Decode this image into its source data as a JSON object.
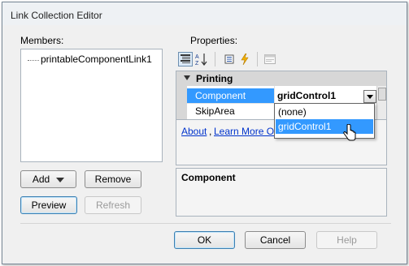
{
  "window": {
    "title": "Link Collection Editor"
  },
  "members": {
    "label": "Members:",
    "items": [
      {
        "label": "printableComponentLink1"
      }
    ]
  },
  "properties": {
    "label": "Properties:",
    "toolbar": [
      "categorized-icon",
      "alphabetical-icon",
      "property-pages-icon",
      "events-icon",
      "properties-icon"
    ],
    "category": "Printing",
    "rows": [
      {
        "name": "Component",
        "value": "gridControl1",
        "selected": true
      },
      {
        "name": "SkipArea",
        "value": ""
      }
    ],
    "dropdown_options": [
      "(none)",
      "gridControl1"
    ],
    "dropdown_highlighted": "gridControl1",
    "links": [
      "About",
      "Learn More Or"
    ],
    "links_separator": ",",
    "description_title": "Component"
  },
  "buttons": {
    "add": "Add",
    "remove": "Remove",
    "preview": "Preview",
    "refresh": "Refresh",
    "ok": "OK",
    "cancel": "Cancel",
    "help": "Help"
  },
  "colors": {
    "selection": "#3399ff",
    "link": "#0033cc"
  }
}
